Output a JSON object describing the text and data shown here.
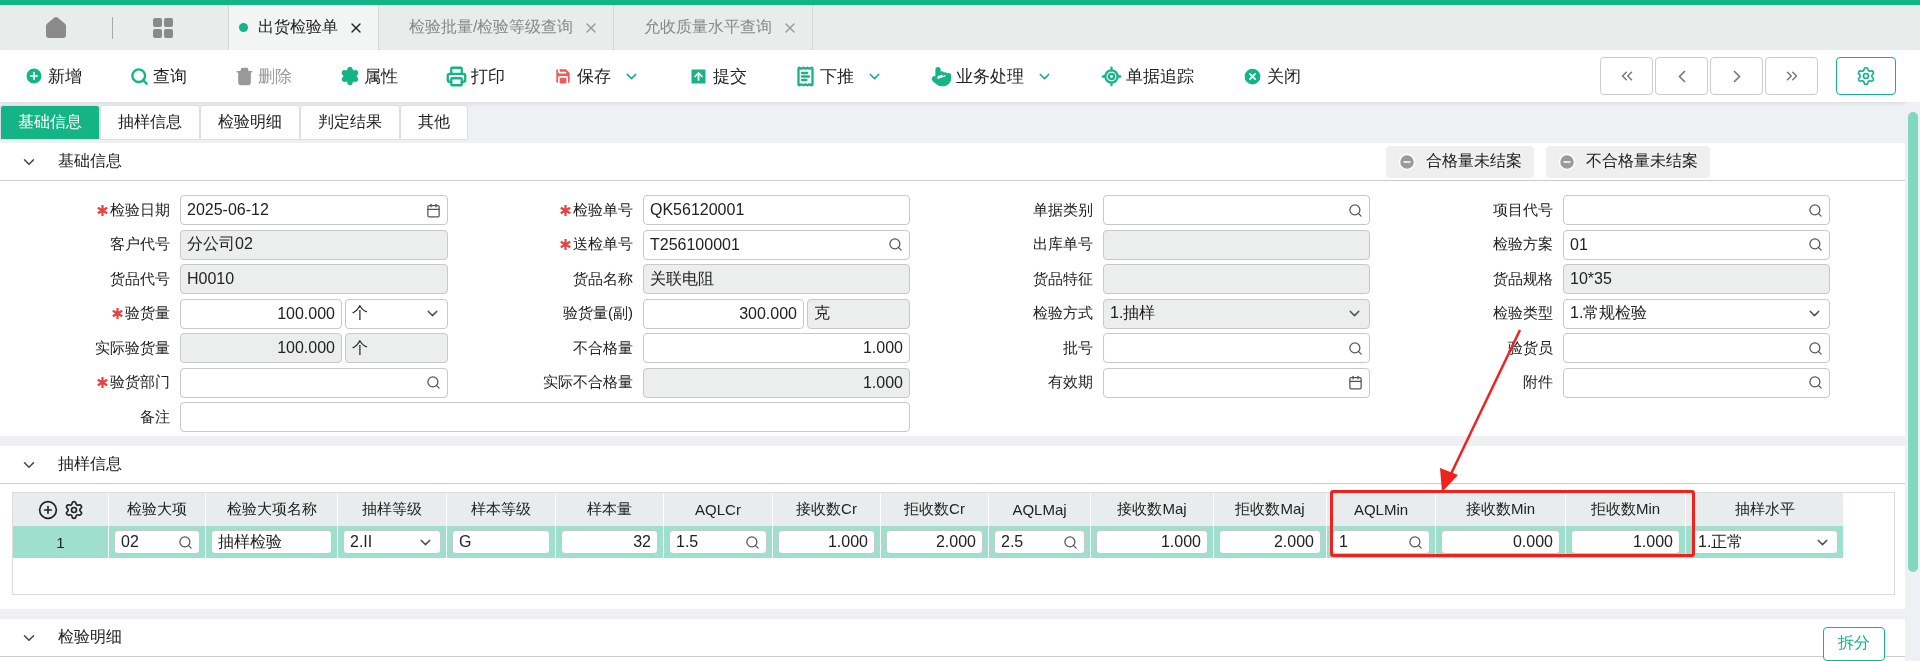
{
  "page_tabs": [
    {
      "label": "出货检验单",
      "selected": true
    },
    {
      "label": "检验批量/检验等级查询",
      "selected": false
    },
    {
      "label": "允收质量水平查询",
      "selected": false
    }
  ],
  "toolbar": [
    {
      "label": "新增",
      "disabled": false,
      "dropdown": false
    },
    {
      "label": "查询",
      "disabled": false,
      "dropdown": false
    },
    {
      "label": "删除",
      "disabled": true,
      "dropdown": false
    },
    {
      "label": "属性",
      "disabled": false,
      "dropdown": false
    },
    {
      "label": "打印",
      "disabled": false,
      "dropdown": false
    },
    {
      "label": "保存",
      "disabled": false,
      "dropdown": true
    },
    {
      "label": "提交",
      "disabled": false,
      "dropdown": false
    },
    {
      "label": "下推",
      "disabled": false,
      "dropdown": true
    },
    {
      "label": "业务处理",
      "disabled": false,
      "dropdown": true
    },
    {
      "label": "单据追踪",
      "disabled": false,
      "dropdown": false
    },
    {
      "label": "关闭",
      "disabled": false,
      "dropdown": false
    }
  ],
  "form_tabs": [
    {
      "label": "基础信息",
      "selected": true
    },
    {
      "label": "抽样信息",
      "selected": false
    },
    {
      "label": "检验明细",
      "selected": false
    },
    {
      "label": "判定结果",
      "selected": false
    },
    {
      "label": "其他",
      "selected": false
    }
  ],
  "basic_info": {
    "title": "基础信息",
    "expanded": true,
    "actions": [
      "合格量未结案",
      "不合格量未结案"
    ],
    "fields": [
      {
        "label": "检验日期",
        "required": true,
        "kind": "date",
        "readonly": false,
        "value": "2025-06-12"
      },
      {
        "label": "检验单号",
        "required": true,
        "kind": "text",
        "readonly": false,
        "value": "QK56120001"
      },
      {
        "label": "单据类别",
        "required": false,
        "kind": "search",
        "readonly": false
      },
      {
        "label": "项目代号",
        "required": false,
        "kind": "search",
        "readonly": false
      },
      {
        "label": "客户代号",
        "required": false,
        "kind": "text",
        "readonly": true,
        "value": "分公司02"
      },
      {
        "label": "送检单号",
        "required": true,
        "kind": "search",
        "readonly": false,
        "value": "T256100001"
      },
      {
        "label": "出库单号",
        "required": false,
        "kind": "text",
        "readonly": true
      },
      {
        "label": "检验方案",
        "required": false,
        "kind": "search",
        "readonly": false,
        "value": "01"
      },
      {
        "label": "货品代号",
        "required": false,
        "kind": "text",
        "readonly": true,
        "value": "H0010"
      },
      {
        "label": "货品名称",
        "required": false,
        "kind": "text",
        "readonly": true,
        "value": "关联电阻"
      },
      {
        "label": "货品特征",
        "required": false,
        "kind": "text",
        "readonly": true
      },
      {
        "label": "货品规格",
        "required": false,
        "kind": "text",
        "readonly": true,
        "value": "10*35"
      },
      {
        "label": "验货量",
        "required": true,
        "kind": "quantity",
        "readonly": false,
        "value": "100.000",
        "unit": {
          "value": "个",
          "kind": "select",
          "readonly": false
        }
      },
      {
        "label": "验货量(副)",
        "required": false,
        "kind": "quantity",
        "readonly": false,
        "value": "300.000",
        "unit": {
          "value": "克",
          "kind": "text",
          "readonly": true
        }
      },
      {
        "label": "检验方式",
        "required": false,
        "kind": "select",
        "readonly": true,
        "value": "1.抽样"
      },
      {
        "label": "检验类型",
        "required": false,
        "kind": "select",
        "readonly": false,
        "value": "1.常规检验"
      },
      {
        "label": "实际验货量",
        "required": false,
        "kind": "quantity",
        "readonly": true,
        "value": "100.000",
        "unit": {
          "value": "个",
          "kind": "text",
          "readonly": true
        }
      },
      {
        "label": "不合格量",
        "required": false,
        "kind": "number",
        "readonly": false,
        "value": "1.000"
      },
      {
        "label": "批号",
        "required": false,
        "kind": "search",
        "readonly": false
      },
      {
        "label": "验货员",
        "required": false,
        "kind": "search",
        "readonly": false
      },
      {
        "label": "验货部门",
        "required": true,
        "kind": "search",
        "readonly": false
      },
      {
        "label": "实际不合格量",
        "required": false,
        "kind": "number",
        "readonly": true,
        "value": "1.000"
      },
      {
        "label": "有效期",
        "required": false,
        "kind": "date",
        "readonly": false
      },
      {
        "label": "附件",
        "required": false,
        "kind": "search",
        "readonly": false
      },
      {
        "label": "备注",
        "required": false,
        "kind": "wide",
        "readonly": false
      }
    ]
  },
  "sampling_info": {
    "title": "抽样信息",
    "expanded": true,
    "table": {
      "columns": [
        {
          "label": "检验大项",
          "highlighted": false
        },
        {
          "label": "检验大项名称",
          "highlighted": false
        },
        {
          "label": "抽样等级",
          "highlighted": false
        },
        {
          "label": "样本等级",
          "highlighted": false
        },
        {
          "label": "样本量",
          "highlighted": false
        },
        {
          "label": "AQLCr",
          "highlighted": false
        },
        {
          "label": "接收数Cr",
          "highlighted": false
        },
        {
          "label": "拒收数Cr",
          "highlighted": false
        },
        {
          "label": "AQLMaj",
          "highlighted": false
        },
        {
          "label": "接收数Maj",
          "highlighted": false
        },
        {
          "label": "拒收数Maj",
          "highlighted": false
        },
        {
          "label": "AQLMin",
          "highlighted": true
        },
        {
          "label": "接收数Min",
          "highlighted": true
        },
        {
          "label": "拒收数Min",
          "highlighted": true
        },
        {
          "label": "抽样水平",
          "highlighted": false
        }
      ],
      "rows": [
        {
          "number": "1",
          "selected": true,
          "cells": [
            {
              "kind": "search",
              "value": "02"
            },
            {
              "kind": "text",
              "value": "抽样检验"
            },
            {
              "kind": "select",
              "value": "2.II"
            },
            {
              "kind": "text",
              "value": "G"
            },
            {
              "kind": "number",
              "value": "32"
            },
            {
              "kind": "search",
              "value": "1.5"
            },
            {
              "kind": "number",
              "value": "1.000"
            },
            {
              "kind": "number",
              "value": "2.000"
            },
            {
              "kind": "search",
              "value": "2.5"
            },
            {
              "kind": "number",
              "value": "1.000"
            },
            {
              "kind": "number",
              "value": "2.000"
            },
            {
              "kind": "search",
              "value": "1"
            },
            {
              "kind": "number",
              "value": "0.000"
            },
            {
              "kind": "number",
              "value": "1.000"
            },
            {
              "kind": "select",
              "value": "1.正常"
            }
          ]
        }
      ]
    }
  },
  "inspection_detail": {
    "title": "检验明细",
    "expanded": true,
    "actions": [
      "拆分"
    ]
  }
}
